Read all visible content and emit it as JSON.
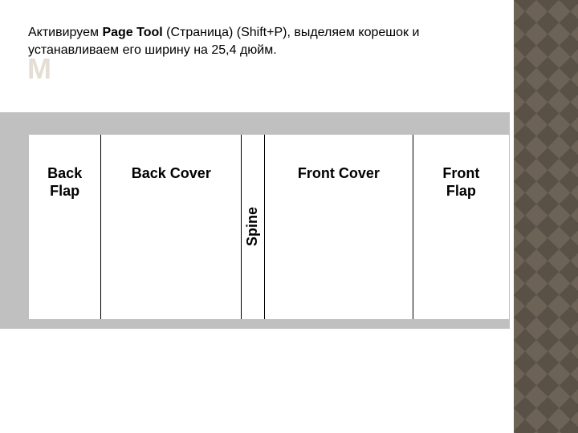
{
  "instruction": {
    "pre": "Активируем ",
    "bold": "Page Tool",
    "post": " (Страница) (Shift+P), выделяем корешок и устанавливаем его ширину на 25,4 дюйм."
  },
  "watermark": "М",
  "cover": {
    "back_flap": "Back\nFlap",
    "back_cover": "Back Cover",
    "spine": "Spine",
    "front_cover": "Front Cover",
    "front_flap": "Front\nFlap"
  }
}
